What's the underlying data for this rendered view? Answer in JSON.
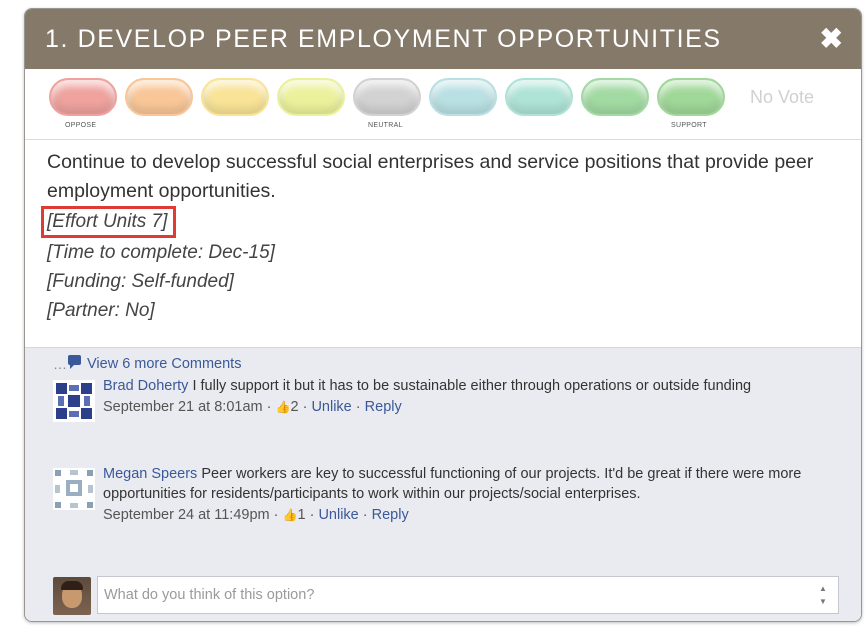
{
  "header": {
    "title": "1. DEVELOP PEER EMPLOYMENT OPPORTUNITIES",
    "close_icon": "close-icon"
  },
  "votes": {
    "options": [
      {
        "color": "#e9a3a0"
      },
      {
        "color": "#f4c79c"
      },
      {
        "color": "#f6e39d"
      },
      {
        "color": "#ebf0a2"
      },
      {
        "color": "#d2d2d2"
      },
      {
        "color": "#bcdfe2"
      },
      {
        "color": "#b2e2d6"
      },
      {
        "color": "#a5d9a6"
      },
      {
        "color": "#a3d69c"
      }
    ],
    "labels": {
      "oppose": "OPPOSE",
      "neutral": "NEUTRAL",
      "support": "SUPPORT"
    },
    "no_vote": "No Vote"
  },
  "option": {
    "description": "Continue to develop successful social enterprises and service positions that provide peer employment opportunities.",
    "effort": "[Effort Units 7]",
    "time": "[Time to complete: Dec-15]",
    "funding": "[Funding: Self-funded]",
    "partner": "[Partner: No]"
  },
  "comments": {
    "view_more": "View 6 more Comments",
    "items": [
      {
        "author": "Brad Doherty",
        "text": "I fully support it but it has to be sustainable either through operations or outside funding",
        "time": "September 21 at 8:01am",
        "likes": "2",
        "unlike": "Unlike",
        "reply": "Reply"
      },
      {
        "author": "Megan Speers",
        "text": "Peer workers are key to successful functioning of our projects. It'd be great if there were more opportunities for residents/participants to work within our projects/social enterprises.",
        "time": "September 24 at 11:49pm",
        "likes": "1",
        "unlike": "Unlike",
        "reply": "Reply"
      }
    ],
    "input_placeholder": "What do you think of this option?",
    "separator": "·"
  }
}
